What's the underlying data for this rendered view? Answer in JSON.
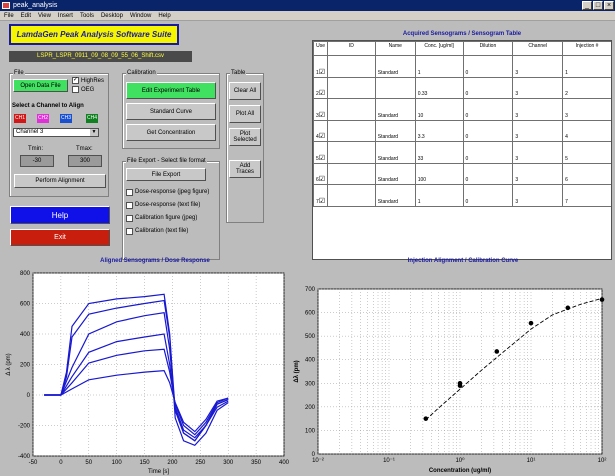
{
  "window": {
    "title": "peak_analysis"
  },
  "menu": [
    "File",
    "Edit",
    "View",
    "Insert",
    "Tools",
    "Desktop",
    "Window",
    "Help"
  ],
  "app_title": "LamdaGen Peak Analysis Software Suite",
  "filename": "LSPR_LSPR_0911_09_08_09_55_06_Shift.csv",
  "file_panel": {
    "title": "File",
    "open_button": "Open Data File",
    "highres_label": "HighRes",
    "highres_checked": true,
    "oeg_label": "OEG",
    "oeg_checked": false,
    "align_heading": "Select a Channel to Align",
    "channel_buttons": [
      {
        "label": "CH1",
        "color": "#d01818"
      },
      {
        "label": "CH2",
        "color": "#e030d8"
      },
      {
        "label": "CH3",
        "color": "#1850d0"
      },
      {
        "label": "CH4",
        "color": "#108020"
      }
    ],
    "channel_select": "Channel 3",
    "tmin_label": "Tmin:",
    "tmin_value": "-30",
    "tmax_label": "Tmax:",
    "tmax_value": "300",
    "align_button": "Perform Alignment"
  },
  "help_button": "Help",
  "exit_button": "Exit",
  "calibration_panel": {
    "title": "Calibration",
    "edit_button": "Edit Experiment Table",
    "standard_button": "Standard Curve",
    "conc_button": "Get Concentration"
  },
  "table_panel": {
    "title": "Table",
    "clear_button": "Clear All",
    "plot_all_button": "Plot All",
    "plot_selected_button": "Plot Selected",
    "add_traces_button": "Add Traces"
  },
  "export_panel": {
    "title": "File Export - Select file format",
    "export_button": "File Export",
    "options": [
      "Dose-response (jpeg figure)",
      "Dose-response (text file)",
      "Calibration figure (jpeg)",
      "Calibration (text file)"
    ]
  },
  "table": {
    "title": "Acquired Sensograms / Sensogram Table",
    "headers": [
      "Use",
      "ID",
      "Name",
      "Conc. [ug/ml]",
      "Dilution",
      "Channel",
      "Injection #"
    ],
    "rows": [
      {
        "use": "1",
        "id": "",
        "name": "Standard",
        "conc": "1",
        "dilution": "0",
        "channel": "3",
        "injection": "1"
      },
      {
        "use": "2",
        "id": "",
        "name": "",
        "conc": "0.33",
        "dilution": "0",
        "channel": "3",
        "injection": "2"
      },
      {
        "use": "3",
        "id": "",
        "name": "Standard",
        "conc": "10",
        "dilution": "0",
        "channel": "3",
        "injection": "3"
      },
      {
        "use": "4",
        "id": "",
        "name": "Standard",
        "conc": "3.3",
        "dilution": "0",
        "channel": "3",
        "injection": "4"
      },
      {
        "use": "5",
        "id": "",
        "name": "Standard",
        "conc": "33",
        "dilution": "0",
        "channel": "3",
        "injection": "5"
      },
      {
        "use": "6",
        "id": "",
        "name": "Standard",
        "conc": "100",
        "dilution": "0",
        "channel": "3",
        "injection": "6"
      },
      {
        "use": "7",
        "id": "",
        "name": "Standard",
        "conc": "1",
        "dilution": "0",
        "channel": "3",
        "injection": "7"
      }
    ]
  },
  "colors": {
    "accent": "#1a1aa0",
    "help": "#1010e8",
    "exit": "#c81e0e",
    "green": "#40e060",
    "title_yellow": "#f5f500"
  },
  "chart_data": [
    {
      "type": "line",
      "title": "Aligned Sensograms / Dose Response",
      "xlabel": "Time [s]",
      "ylabel": "Δ λ (pm)",
      "xlim": [
        -50,
        400
      ],
      "ylim": [
        -400,
        800
      ],
      "xticks": [
        -50,
        0,
        50,
        100,
        150,
        200,
        250,
        300,
        350,
        400
      ],
      "yticks": [
        -400,
        -200,
        0,
        200,
        400,
        600,
        800
      ],
      "grid": true,
      "series_color": "#1818d0",
      "series": [
        {
          "x": [
            -30,
            0,
            10,
            20,
            50,
            100,
            150,
            185,
            195,
            205,
            220,
            240,
            260,
            280,
            300
          ],
          "y": [
            0,
            0,
            150,
            450,
            600,
            630,
            645,
            660,
            400,
            -150,
            -300,
            -330,
            -250,
            -100,
            -50
          ]
        },
        {
          "x": [
            -30,
            0,
            10,
            20,
            50,
            100,
            150,
            185,
            195,
            205,
            220,
            240,
            260,
            280,
            300
          ],
          "y": [
            0,
            0,
            120,
            380,
            530,
            570,
            600,
            620,
            380,
            -100,
            -250,
            -300,
            -200,
            -80,
            -40
          ]
        },
        {
          "x": [
            -30,
            0,
            20,
            50,
            100,
            150,
            185,
            195,
            205,
            220,
            240,
            260,
            280,
            300
          ],
          "y": [
            0,
            0,
            180,
            400,
            480,
            520,
            540,
            300,
            -100,
            -250,
            -300,
            -200,
            -60,
            -30
          ]
        },
        {
          "x": [
            -30,
            0,
            20,
            50,
            100,
            150,
            185,
            195,
            205,
            220,
            240,
            260,
            280,
            300
          ],
          "y": [
            0,
            0,
            120,
            280,
            350,
            380,
            400,
            200,
            -80,
            -230,
            -280,
            -200,
            -60,
            -30
          ]
        },
        {
          "x": [
            -30,
            0,
            20,
            50,
            100,
            150,
            185,
            195,
            205,
            220,
            240,
            260,
            280,
            300
          ],
          "y": [
            0,
            0,
            80,
            210,
            260,
            290,
            300,
            150,
            -60,
            -200,
            -260,
            -180,
            -50,
            -20
          ]
        },
        {
          "x": [
            -30,
            0,
            20,
            50,
            100,
            150,
            185,
            195,
            205,
            220,
            240,
            260,
            280,
            300
          ],
          "y": [
            0,
            0,
            40,
            100,
            130,
            150,
            160,
            80,
            -50,
            -180,
            -240,
            -160,
            -40,
            -20
          ]
        }
      ]
    },
    {
      "type": "scatter",
      "title": "Injection Alignment / Calibration Curve",
      "xlabel": "Concentration (ug/ml)",
      "ylabel": "Δλ (pm)",
      "xscale": "log",
      "xlim": [
        0.1,
        100
      ],
      "ylim": [
        0,
        700
      ],
      "yticks": [
        0,
        100,
        200,
        300,
        400,
        500,
        600,
        700
      ],
      "xtick_labels": [
        "10⁻¹",
        "10⁰",
        "10¹",
        "10²"
      ],
      "grid": true,
      "points": [
        {
          "x": 0.33,
          "y": 150
        },
        {
          "x": 1,
          "y": 290
        },
        {
          "x": 1,
          "y": 300
        },
        {
          "x": 3.3,
          "y": 435
        },
        {
          "x": 10,
          "y": 555
        },
        {
          "x": 33,
          "y": 620
        },
        {
          "x": 100,
          "y": 655
        }
      ],
      "fit_curve": {
        "x": [
          0.33,
          0.5,
          1,
          2,
          3.3,
          5,
          10,
          20,
          33,
          50,
          100
        ],
        "y": [
          145,
          195,
          275,
          355,
          410,
          455,
          530,
          590,
          615,
          635,
          660
        ]
      }
    }
  ]
}
